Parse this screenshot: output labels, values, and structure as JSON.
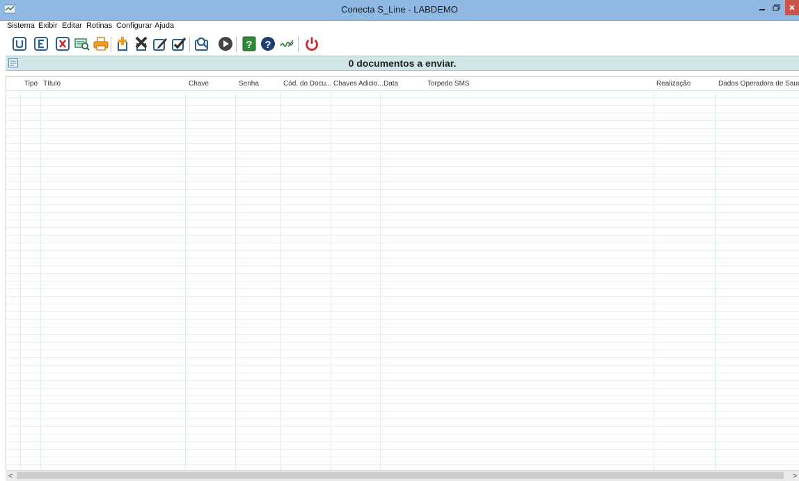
{
  "window": {
    "title": "Conecta S_Line - LABDEMO"
  },
  "menu": [
    "Sistema",
    "Exibir",
    "Editar",
    "Rotinas",
    "Configurar",
    "Ajuda"
  ],
  "toolbar_icons": [
    "import-icon",
    "export-icon",
    "delete-icon",
    "preview-icon",
    "print-icon",
    "add-icon",
    "remove-icon",
    "edit-icon",
    "approve-icon",
    "search-icon",
    "play-icon",
    "help-book-icon",
    "question-icon",
    "signature-icon",
    "power-icon"
  ],
  "status": {
    "text": "0 documentos a enviar."
  },
  "table": {
    "columns": [
      "Tipo",
      "Título",
      "Chave",
      "Senha",
      "Cód. do Docu...",
      "Chaves Adicio...",
      "Data",
      "Torpedo SMS",
      "Realização",
      "Dados Operadora de Saude"
    ]
  },
  "scrollbar": {
    "left_arrow": "<",
    "right_arrow": ">"
  },
  "colors": {
    "titlebar": "#8fb8e2",
    "statusbar": "#d2e6e6",
    "close_button": "#c9544a",
    "grid_line": "#e6f1ec"
  }
}
